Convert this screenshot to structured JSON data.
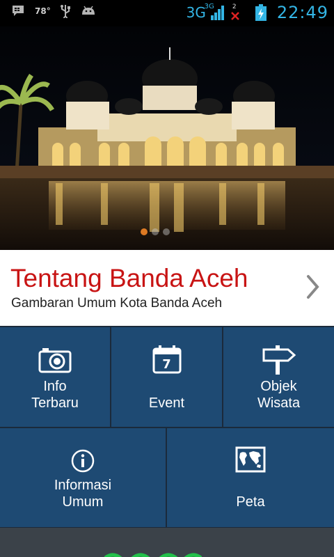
{
  "status_bar": {
    "temperature": "78°",
    "network": "3G",
    "network_sup": "3G",
    "sim_indicator": "2",
    "clock": "22:49",
    "icons": [
      "bbm-icon",
      "usb-icon",
      "android-debug-icon",
      "signal-icon",
      "sim-x-icon",
      "battery-charging-icon"
    ]
  },
  "hero": {
    "slide_count": 3,
    "active_slide": 0
  },
  "about": {
    "title": "Tentang Banda Aceh",
    "subtitle": "Gambaran Umum Kota Banda Aceh"
  },
  "menu": [
    {
      "label1": "Info",
      "label2": "Terbaru",
      "icon": "camera-icon"
    },
    {
      "label1": "",
      "label2": "Event",
      "icon": "calendar-icon",
      "badge": "7"
    },
    {
      "label1": "Objek",
      "label2": "Wisata",
      "icon": "signpost-icon"
    },
    {
      "label1": "Informasi",
      "label2": "Umum",
      "icon": "info-icon"
    },
    {
      "label1": "",
      "label2": "Peta",
      "icon": "map-icon"
    }
  ],
  "colors": {
    "accent_red": "#c81414",
    "tile_blue": "#1e4a73",
    "status_blue": "#33b5e5"
  }
}
